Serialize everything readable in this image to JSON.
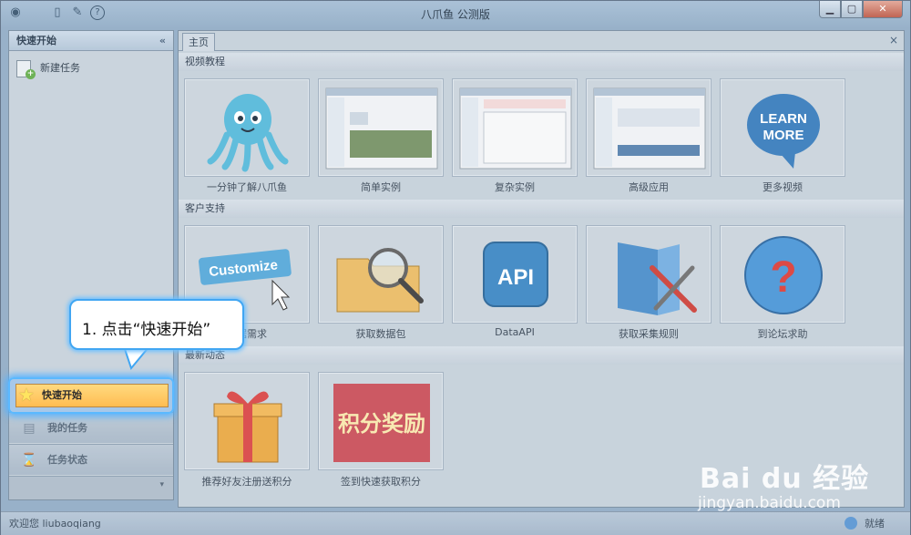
{
  "window": {
    "title": "八爪鱼 公测版",
    "controls": {
      "minimize": "▁",
      "maximize": "▢",
      "close": "✕"
    }
  },
  "sidebar": {
    "header": "快速开始",
    "collapse_glyph": "«",
    "new_task": "新建任务",
    "nav": {
      "quick_start": "快速开始",
      "my_tasks": "我的任务",
      "task_status": "任务状态"
    }
  },
  "main": {
    "tab": "主页",
    "tab_close": "×",
    "sections": {
      "video": {
        "title": "视频教程",
        "items": [
          "一分钟了解八爪鱼",
          "简单实例",
          "复杂实例",
          "高级应用",
          "更多视频"
        ]
      },
      "support": {
        "title": "客户支持",
        "items": [
          "数据需求",
          "获取数据包",
          "DataAPI",
          "获取采集规则",
          "到论坛求助"
        ]
      },
      "latest": {
        "title": "最新动态",
        "items": [
          "推荐好友注册送积分",
          "签到快速获取积分"
        ]
      }
    },
    "thumb_text": {
      "learn_more": [
        "LEARN",
        "MORE"
      ],
      "customize": "Customize",
      "api": "API",
      "help": "?",
      "points": "积分奖励"
    }
  },
  "callout": {
    "text": "1. 点击“快速开始”"
  },
  "status": {
    "user": "欢迎您 liubaoqiang",
    "ready": "就绪"
  },
  "watermark": {
    "brand": "Bai du 经验",
    "url": "jingyan.baidu.com"
  },
  "colors": {
    "accent": "#41a6f2",
    "highlight": "#ffb43a"
  }
}
